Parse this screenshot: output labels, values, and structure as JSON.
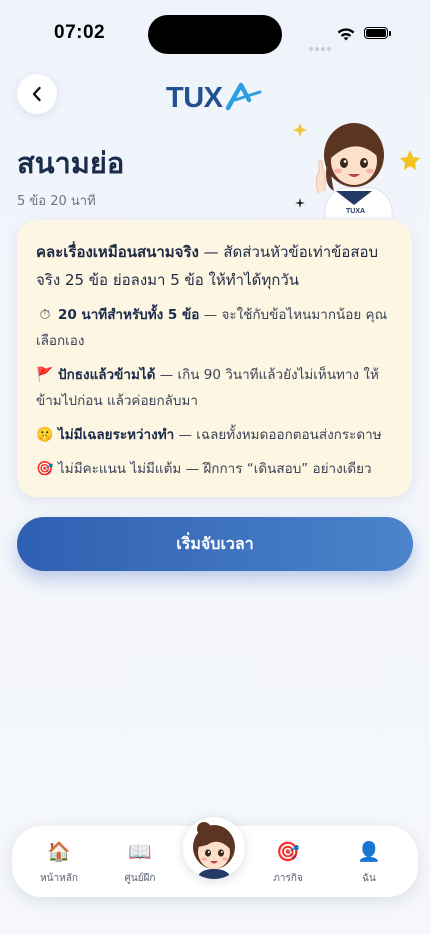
{
  "status": {
    "time": "07:02"
  },
  "header": {
    "logo_text": "TUXA"
  },
  "page": {
    "title": "สนามย่อ",
    "subtitle": "5 ข้อ 20 นาที"
  },
  "card": {
    "intro_bold": "คละเรื่องเหมือนสนามจริง",
    "intro_rest": " — สัดส่วนหัวข้อเท่าข้อสอบจริง 25 ข้อ ย่อลงมา 5 ข้อ ให้ทำได้ทุกวัน",
    "rules": [
      {
        "icon": "⏱",
        "bold": "20 นาทีสำหรับทั้ง 5 ข้อ",
        "text": " — จะใช้กับข้อไหนมากน้อย คุณเลือกเอง"
      },
      {
        "icon": "🚩",
        "bold": "ปักธงแล้วข้ามได้",
        "text": " — เกิน 90 วินาทีแล้วยังไม่เห็นทาง ให้ข้ามไปก่อน แล้วค่อยกลับมา"
      },
      {
        "icon": "🤫",
        "bold": "ไม่มีเฉลยระหว่างทำ",
        "text": " — เฉลยทั้งหมดออกตอนส่งกระดาษ"
      },
      {
        "icon": "🎯",
        "bold": "",
        "text": "ไม่มีคะแนน ไม่มีแต้ม — ฝึกการ “เดินสอบ” อย่างเดียว"
      }
    ]
  },
  "start_button": {
    "label": "เริ่มจับเวลา"
  },
  "tabbar": {
    "items": [
      {
        "icon": "🏠",
        "label": "หน้าหลัก"
      },
      {
        "icon": "📖",
        "label": "ศูนย์ฝึก"
      },
      {
        "icon": "🎯",
        "label": "ภารกิจ"
      },
      {
        "icon": "👤",
        "label": "ฉัน"
      }
    ]
  },
  "colors": {
    "accent": "#3a6fbf",
    "card_bg": "#fdf6e3",
    "title": "#1b2b4c"
  }
}
